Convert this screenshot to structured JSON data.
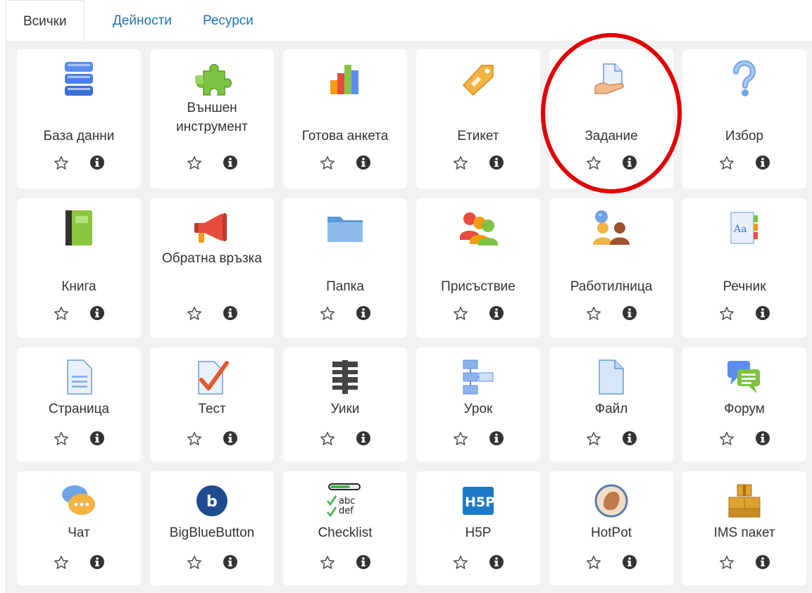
{
  "tabs": [
    {
      "label": "Всички"
    },
    {
      "label": "Дейности"
    },
    {
      "label": "Ресурси"
    }
  ],
  "modules": [
    {
      "name": "База данни",
      "icon": "database-icon"
    },
    {
      "name": "Външен инструмент",
      "icon": "puzzle-icon"
    },
    {
      "name": "Готова анкета",
      "icon": "bar-chart-icon"
    },
    {
      "name": "Етикет",
      "icon": "tag-icon"
    },
    {
      "name": "Задание",
      "icon": "assignment-icon"
    },
    {
      "name": "Избор",
      "icon": "question-icon"
    },
    {
      "name": "Книга",
      "icon": "book-icon"
    },
    {
      "name": "Обратна връзка",
      "icon": "megaphone-icon"
    },
    {
      "name": "Папка",
      "icon": "folder-icon"
    },
    {
      "name": "Присъствие",
      "icon": "attendance-icon"
    },
    {
      "name": "Работилница",
      "icon": "workshop-icon"
    },
    {
      "name": "Речник",
      "icon": "glossary-icon"
    },
    {
      "name": "Страница",
      "icon": "page-icon"
    },
    {
      "name": "Тест",
      "icon": "quiz-icon"
    },
    {
      "name": "Уики",
      "icon": "wiki-icon"
    },
    {
      "name": "Урок",
      "icon": "lesson-icon"
    },
    {
      "name": "Файл",
      "icon": "file-icon"
    },
    {
      "name": "Форум",
      "icon": "forum-icon"
    },
    {
      "name": "Чат",
      "icon": "chat-icon"
    },
    {
      "name": "BigBlueButton",
      "icon": "bigbluebutton-icon"
    },
    {
      "name": "Checklist",
      "icon": "checklist-icon"
    },
    {
      "name": "H5P",
      "icon": "h5p-icon"
    },
    {
      "name": "HotPot",
      "icon": "hotpot-icon"
    },
    {
      "name": "IMS пакет",
      "icon": "ims-package-icon"
    }
  ],
  "icons_text": {
    "h5p": "H5P",
    "abc": "abc",
    "def": "def",
    "aa": "Aa",
    "b": "b"
  },
  "colors": {
    "link": "#1f72b9",
    "highlight_ring": "#e00000"
  }
}
